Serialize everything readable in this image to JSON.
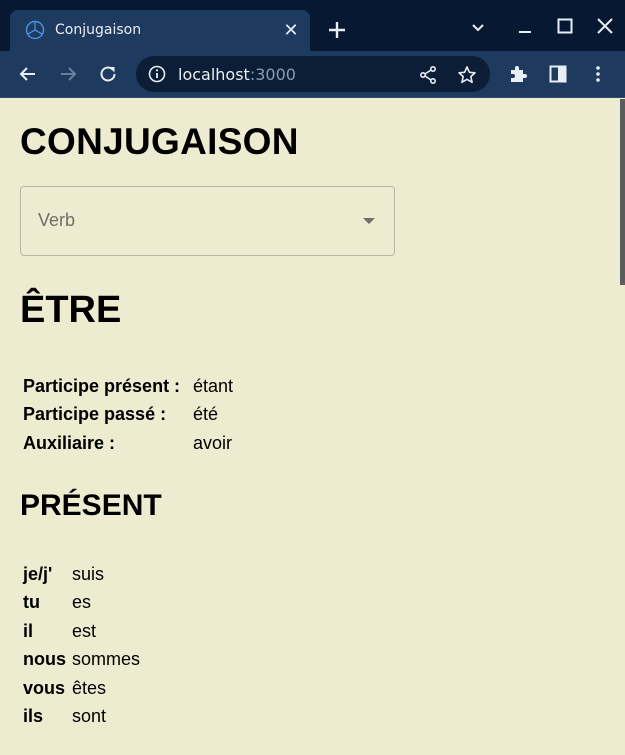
{
  "browser": {
    "tab": {
      "title": "Conjugaison",
      "close_glyph": "✕"
    },
    "address": {
      "host": "localhost",
      "port": ":3000"
    },
    "icons": [
      "browser-favicon",
      "new-tab-icon",
      "tab-list-icon",
      "minimize-icon",
      "maximize-icon",
      "close-window-icon",
      "back-icon",
      "forward-icon",
      "reload-icon",
      "site-info-icon",
      "share-icon",
      "bookmark-star-icon",
      "extensions-icon",
      "side-panel-icon",
      "menu-kebab-icon"
    ],
    "colors": {
      "tabbar": "#071833",
      "toolbar": "#1e3a5f",
      "omnibox": "#0c1e36"
    }
  },
  "page": {
    "title": "CONJUGAISON",
    "verb_select": {
      "placeholder": "Verb"
    },
    "verb": "ÊTRE",
    "info": [
      {
        "label": "Participe présent :",
        "value": "étant"
      },
      {
        "label": "Participe passé :",
        "value": "été"
      },
      {
        "label": "Auxiliaire :",
        "value": "avoir"
      }
    ],
    "tense": "PRÉSENT",
    "conjugations": [
      {
        "pronoun": "je/j'",
        "form": "suis"
      },
      {
        "pronoun": "tu",
        "form": "es"
      },
      {
        "pronoun": "il",
        "form": "est"
      },
      {
        "pronoun": "nous",
        "form": "sommes"
      },
      {
        "pronoun": "vous",
        "form": "êtes"
      },
      {
        "pronoun": "ils",
        "form": "sont"
      }
    ],
    "colors": {
      "background": "#eeecd0",
      "text": "#000000"
    }
  }
}
